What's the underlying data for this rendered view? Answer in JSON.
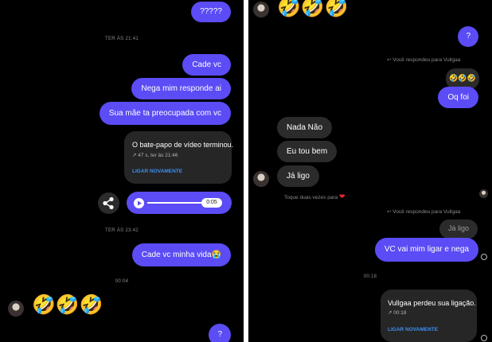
{
  "left": {
    "msg_question": "?????",
    "time1": "TER ÀS 21:41",
    "msg1": "Cade vc",
    "msg2": "Nega mim responde ai",
    "msg3": "Sua mãe ta preocupada com vc",
    "call_title": "O bate-papo de vídeo terminou.",
    "call_sub": "47 s, ter às 21:46",
    "call_link": "LIGAR NOVAMENTE",
    "audio_time": "0:05",
    "time2": "TER ÀS 23:42",
    "msg4": "Cade vc minha vida😭",
    "time3": "00:04",
    "emojis": "🤣🤣🤣",
    "msg_last": "?"
  },
  "right": {
    "emojis": "🤣🤣🤣",
    "msg_question": "?",
    "reply_note1": "Você respondeu para Vullgaa",
    "quoted1": "🤣🤣🤣",
    "msg1": "Oq foi",
    "in1": "Nada Não",
    "in2": "Eu tou bem",
    "in3": "Já ligo",
    "double_tap": "Toque duas vezes para",
    "reply_note2": "Você respondeu para Vullgaa",
    "quoted2": "Já ligo",
    "msg2": "VC vai mim ligar e nega",
    "time": "00:18",
    "call_title": "Vullgaa perdeu sua ligação.",
    "call_sub": "00:18",
    "call_link": "LIGAR NOVAMENTE"
  },
  "colors": {
    "outgoing": "#5b4cf5",
    "incoming": "#2b2b2b",
    "link": "#3d8ff0",
    "heart": "#e5243b"
  }
}
